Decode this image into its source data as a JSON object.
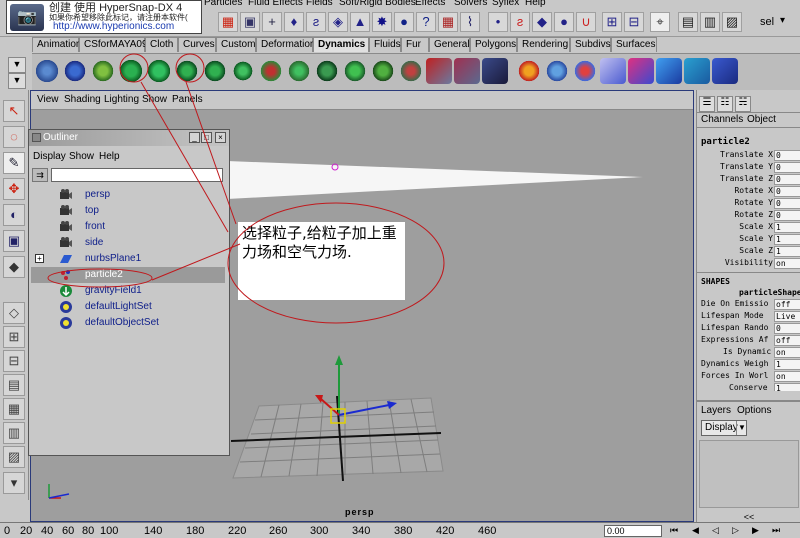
{
  "menu": {
    "items": [
      "Particles",
      "Fluid Effects",
      "Fields",
      "Soft/Rigid Bodies",
      "Effects",
      "Solvers",
      "Syflex",
      "Help"
    ]
  },
  "status": {
    "mode_label": "sel"
  },
  "watermark": {
    "title": "创建 使用 HyperSnap-DX 4",
    "note": "如果你希望移除此标记，请注册本软件(",
    "url": "http://www.hyperionics.com"
  },
  "shelf": {
    "tabs": [
      "Animation",
      "CSforMAYA09",
      "Cloth",
      "Curves",
      "Custom",
      "Deformation",
      "Dynamics",
      "Fluids",
      "Fur",
      "General",
      "Polygons",
      "Rendering",
      "Subdivs",
      "Surfaces"
    ],
    "active_tab": "Dynamics"
  },
  "viewport": {
    "menu": [
      "View",
      "Shading",
      "Lighting",
      "Show",
      "Panels"
    ],
    "camera_label": "persp"
  },
  "outliner": {
    "title": "Outliner",
    "menu": [
      "Display",
      "Show",
      "Help"
    ],
    "items": [
      {
        "label": "persp",
        "icon": "camera-icon"
      },
      {
        "label": "top",
        "icon": "camera-icon"
      },
      {
        "label": "front",
        "icon": "camera-icon"
      },
      {
        "label": "side",
        "icon": "camera-icon"
      },
      {
        "label": "nurbsPlane1",
        "icon": "nurbs-plane-icon",
        "expand": "+"
      },
      {
        "label": "particle2",
        "icon": "particle-icon",
        "selected": true
      },
      {
        "label": "gravityField1",
        "icon": "gravity-field-icon"
      },
      {
        "label": "defaultLightSet",
        "icon": "set-icon"
      },
      {
        "label": "defaultObjectSet",
        "icon": "set-icon"
      }
    ]
  },
  "annotation": {
    "text": "选择粒子,给粒子加上重力场和空气力场."
  },
  "channel_box": {
    "tabs": [
      "Channels",
      "Object"
    ],
    "node_name": "particle2",
    "attributes": [
      {
        "label": "Translate X",
        "value": "0"
      },
      {
        "label": "Translate Y",
        "value": "0"
      },
      {
        "label": "Translate Z",
        "value": "0"
      },
      {
        "label": "Rotate X",
        "value": "0"
      },
      {
        "label": "Rotate Y",
        "value": "0"
      },
      {
        "label": "Rotate Z",
        "value": "0"
      },
      {
        "label": "Scale X",
        "value": "1"
      },
      {
        "label": "Scale Y",
        "value": "1"
      },
      {
        "label": "Scale Z",
        "value": "1"
      },
      {
        "label": "Visibility",
        "value": "on"
      }
    ],
    "shapes_label": "SHAPES",
    "shape_name": "particleShape2",
    "shape_attributes": [
      {
        "label": "Die On Emissio",
        "value": "off"
      },
      {
        "label": "Lifespan Mode",
        "value": "Live"
      },
      {
        "label": "Lifespan Rando",
        "value": "0"
      },
      {
        "label": "Expressions Af",
        "value": "off"
      },
      {
        "label": "Is Dynamic",
        "value": "on"
      },
      {
        "label": "Dynamics Weigh",
        "value": "1"
      },
      {
        "label": "Forces In Worl",
        "value": "on"
      },
      {
        "label": "Conserve",
        "value": "1"
      }
    ]
  },
  "layers": {
    "menu": [
      "Layers",
      "Options"
    ],
    "dropdown": "Display",
    "scroll": "<<"
  },
  "timeline": {
    "ticks": [
      "20",
      "40",
      "60",
      "80",
      "100",
      "140",
      "180",
      "220",
      "260",
      "300",
      "340",
      "380",
      "420",
      "460"
    ],
    "start": "0",
    "frame": "0.00"
  },
  "colors": {
    "annotation_ellipse": "#c0181c",
    "selection": "#9a9a9a",
    "viewport_bg": "#9e9e9e",
    "manip_y": "#1e9a3a",
    "manip_x": "#c81818",
    "manip_z": "#1a2ad0"
  }
}
